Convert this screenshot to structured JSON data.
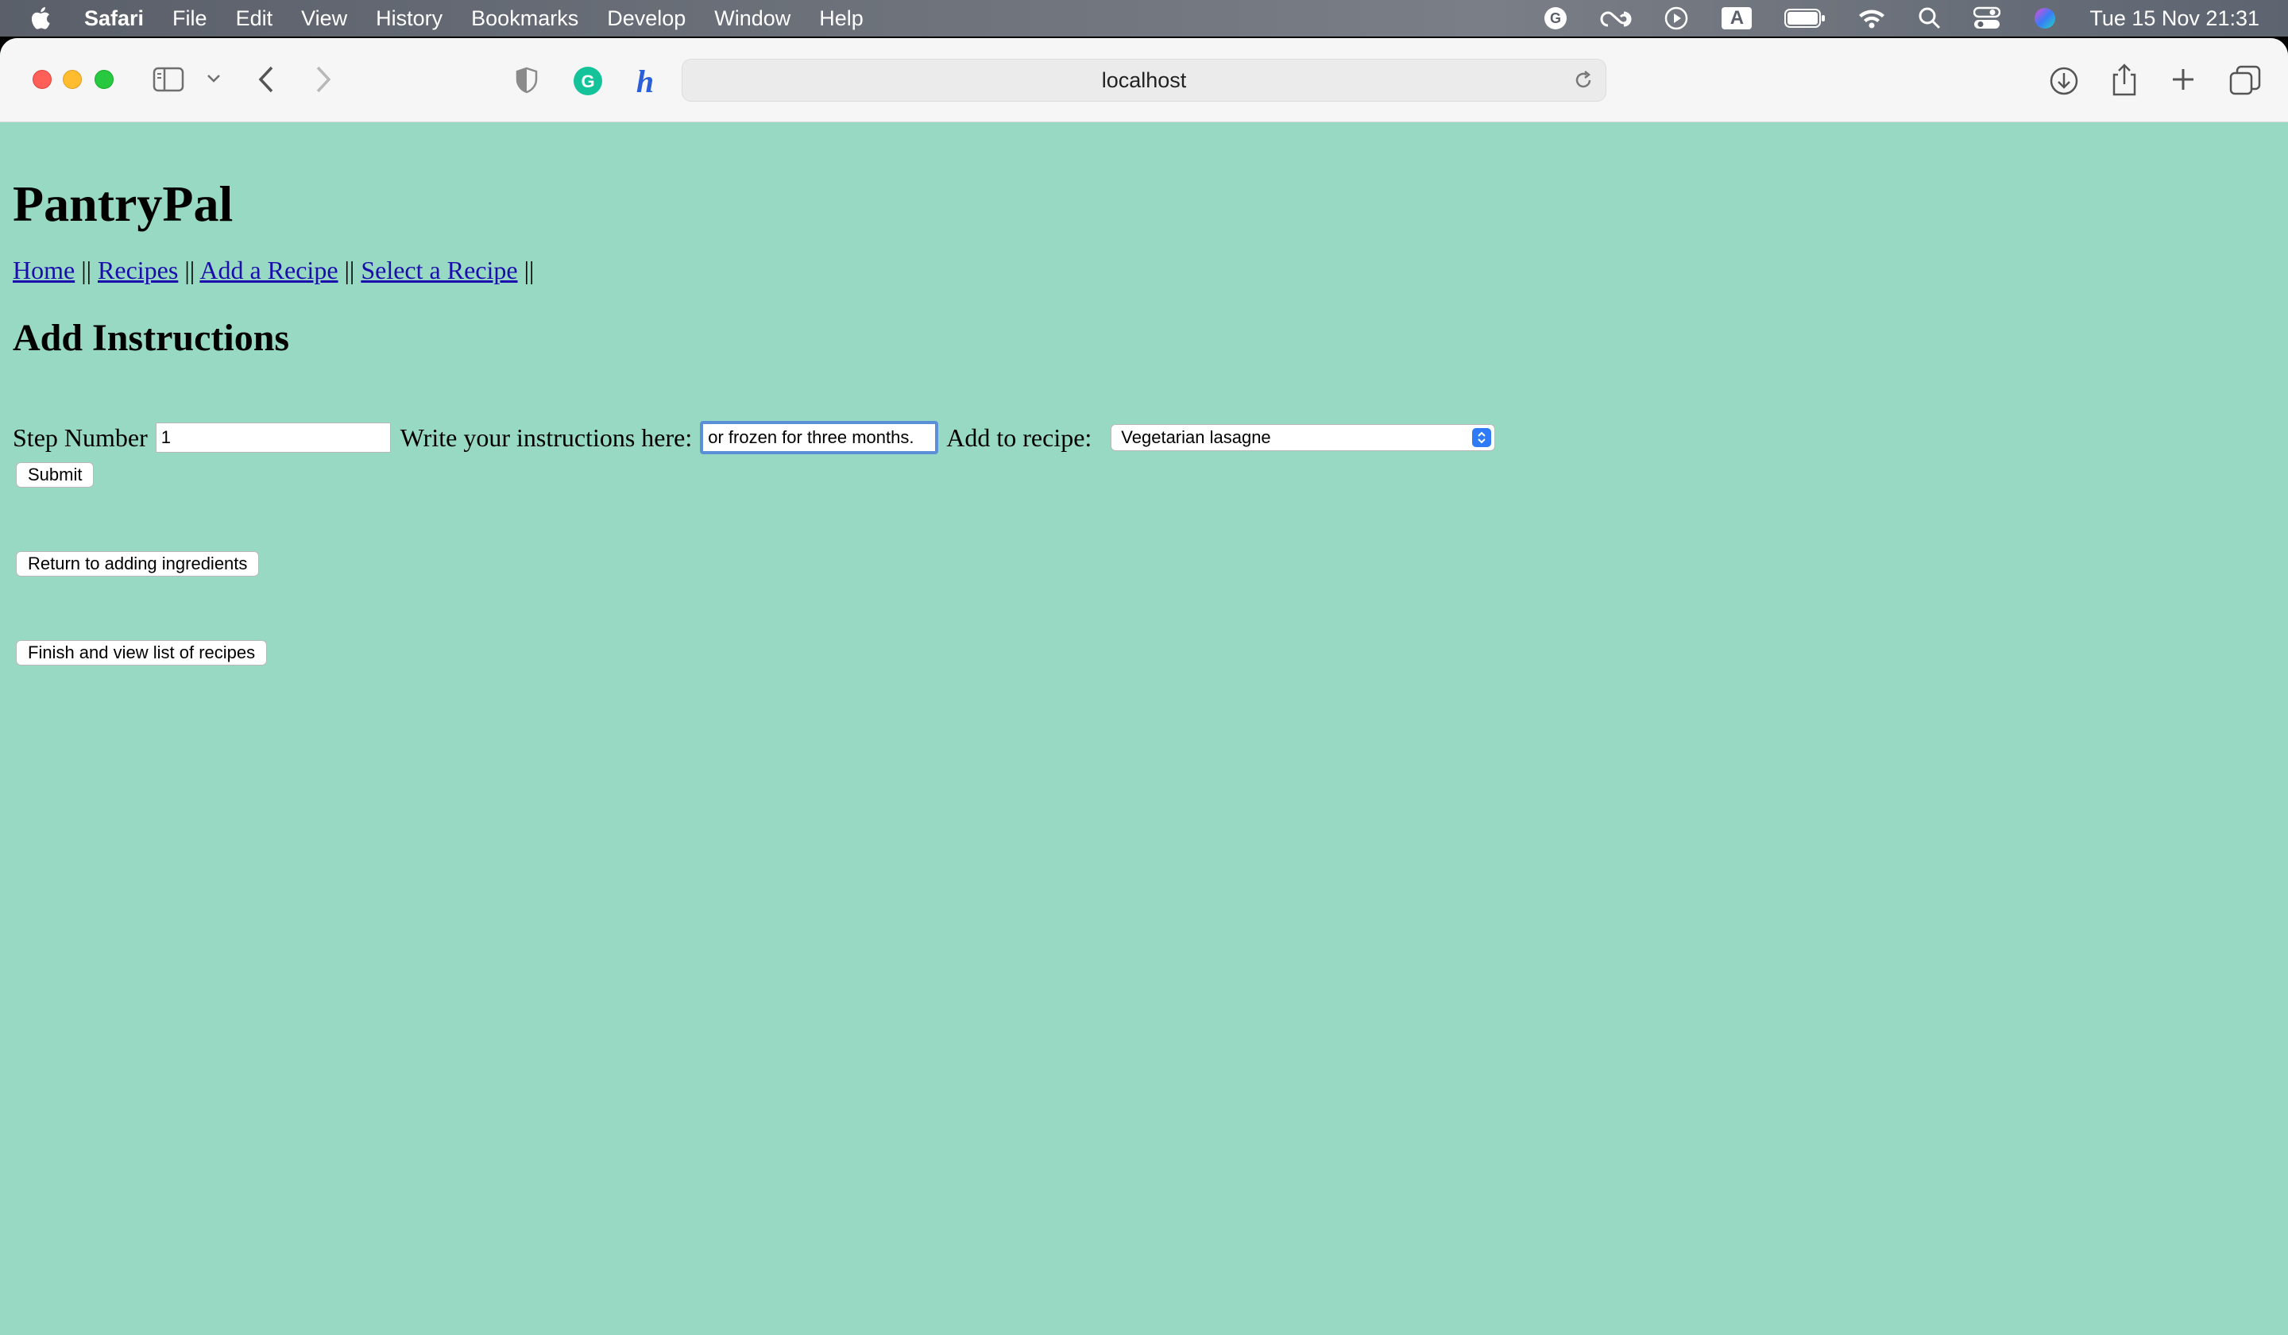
{
  "menubar": {
    "app_name": "Safari",
    "items": [
      "File",
      "Edit",
      "View",
      "History",
      "Bookmarks",
      "Develop",
      "Window",
      "Help"
    ],
    "clock": "Tue 15 Nov  21:31",
    "input_source": "A"
  },
  "browser": {
    "url": "localhost"
  },
  "page": {
    "site_title": "PantryPal",
    "nav": {
      "home": "Home",
      "recipes": "Recipes",
      "add_recipe": "Add a Recipe",
      "select_recipe": "Select a Recipe",
      "separator": "||"
    },
    "section_title": "Add Instructions",
    "form": {
      "step_label": "Step Number",
      "step_value": "1",
      "instructions_label": "Write your instructions here:",
      "instructions_value": "or frozen for three months.",
      "recipe_label": "Add to recipe:",
      "recipe_selected": "Vegetarian lasagne",
      "submit_label": "Submit"
    },
    "return_button": "Return to adding ingredients",
    "finish_button": "Finish and view list of recipes"
  }
}
